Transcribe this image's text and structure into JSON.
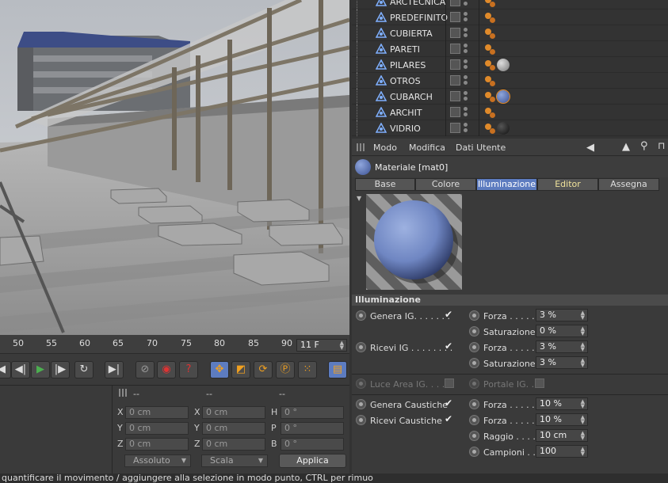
{
  "objects": [
    {
      "name": "ARCTECNICA",
      "material": ""
    },
    {
      "name": "PREDEFINITO",
      "material": ""
    },
    {
      "name": "CUBIERTA",
      "material": ""
    },
    {
      "name": "PARETI",
      "material": ""
    },
    {
      "name": "PILARES",
      "material": "grey"
    },
    {
      "name": "OTROS",
      "material": ""
    },
    {
      "name": "CUBARCH",
      "material": "blue"
    },
    {
      "name": "ARCHIT",
      "material": ""
    },
    {
      "name": "VIDRIO",
      "material": "dark"
    }
  ],
  "attr": {
    "menu": [
      "Modo",
      "Modifica",
      "Dati Utente"
    ],
    "material_title": "Materiale [mat0]",
    "tabs": [
      "Base",
      "Colore",
      "Illuminazione",
      "Editor",
      "Assegna"
    ],
    "active_tab": "Illuminazione",
    "section_title": "Illuminazione",
    "genera_ig": "Genera IG. . . . . . .",
    "ricevi_ig": "Ricevi IG . . . . . . . .",
    "forza": "Forza . . . . .",
    "saturazione": "Saturazione",
    "gen_forza_val": "3 %",
    "gen_sat_val": "0 %",
    "ric_forza_val": "3 %",
    "ric_sat_val": "3 %",
    "luce_area": "Luce Area IG. . . . .",
    "portale": "Portale IG. .",
    "genera_caustiche": "Genera Caustiche",
    "ricevi_caustiche": "Ricevi Caustiche",
    "cau_forza1": "10 %",
    "cau_forza2": "10 %",
    "raggio": "Raggio . . . .",
    "raggio_val": "10 cm",
    "campioni": "Campioni . .",
    "campioni_val": "100"
  },
  "timeline": {
    "ticks": [
      "50",
      "55",
      "60",
      "65",
      "70",
      "75",
      "80",
      "85",
      "90"
    ],
    "frame": "11 F"
  },
  "coords": {
    "header": [
      "--",
      "--",
      "--"
    ],
    "rows": [
      {
        "a": "X",
        "av": "0 cm",
        "b": "X",
        "bv": "0 cm",
        "c": "H",
        "cv": "0 °"
      },
      {
        "a": "Y",
        "av": "0 cm",
        "b": "Y",
        "bv": "0 cm",
        "c": "P",
        "cv": "0 °"
      },
      {
        "a": "Z",
        "av": "0 cm",
        "b": "Z",
        "bv": "0 cm",
        "c": "B",
        "cv": "0 °"
      }
    ],
    "mode": "Assoluto",
    "scale": "Scala",
    "apply": "Applica"
  },
  "status": "quantificare il movimento / aggiungere alla selezione in modo punto, CTRL per rimuo",
  "colors": {
    "accent": "#5d7cc0",
    "editor_tab_text": "#f1e39b",
    "tag": "#e08a2a"
  }
}
